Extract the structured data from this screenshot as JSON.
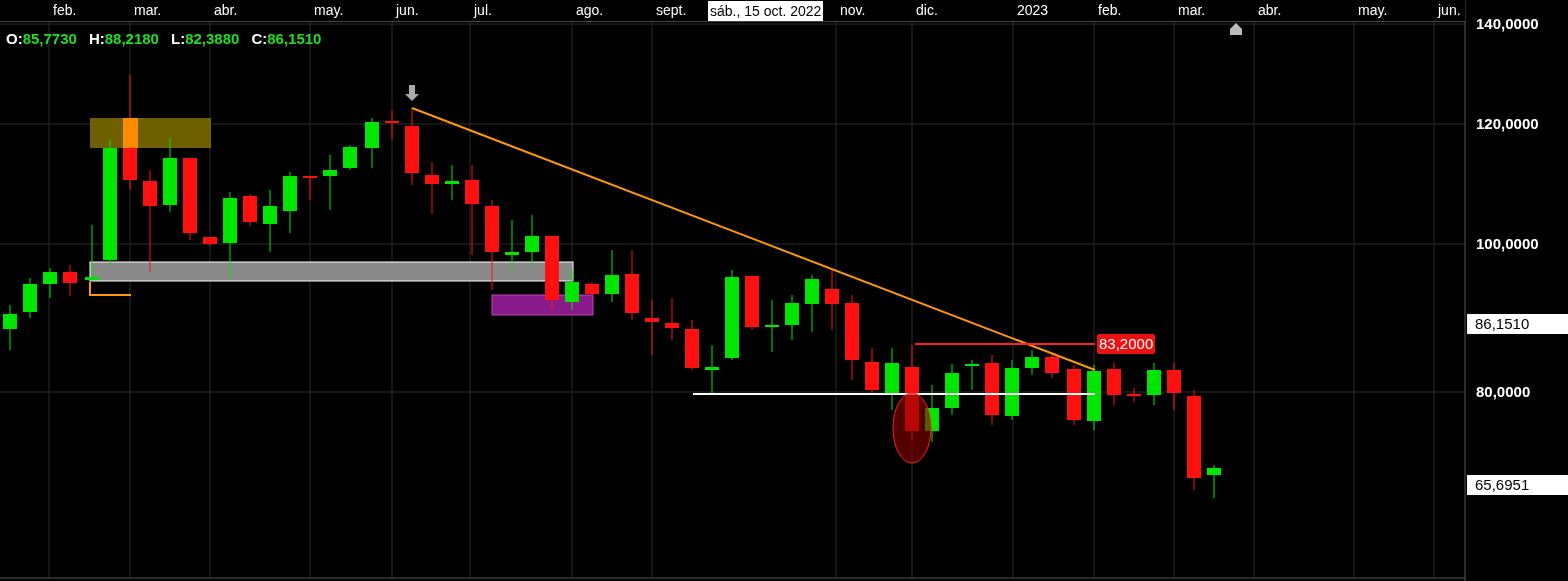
{
  "time_axis": {
    "labels": [
      "feb.",
      "mar.",
      "abr.",
      "may.",
      "jun.",
      "jul.",
      "ago.",
      "sept.",
      "nov.",
      "dic.",
      "2023",
      "feb.",
      "mar.",
      "abr.",
      "may.",
      "jun."
    ]
  },
  "crosshair_date": "sáb., 15 oct. 2022",
  "ohlc": [
    {
      "key": "O:",
      "value": "85,7730"
    },
    {
      "key": "H:",
      "value": "88,2180"
    },
    {
      "key": "L:",
      "value": "82,3880"
    },
    {
      "key": "C:",
      "value": "86,1510"
    }
  ],
  "price_axis": {
    "labels": [
      "140,0000",
      "120,0000",
      "100,0000",
      "80,0000"
    ]
  },
  "price_tags": [
    {
      "text": "86,1510"
    },
    {
      "text": "65,6951"
    }
  ],
  "line_label": "83,2000"
}
